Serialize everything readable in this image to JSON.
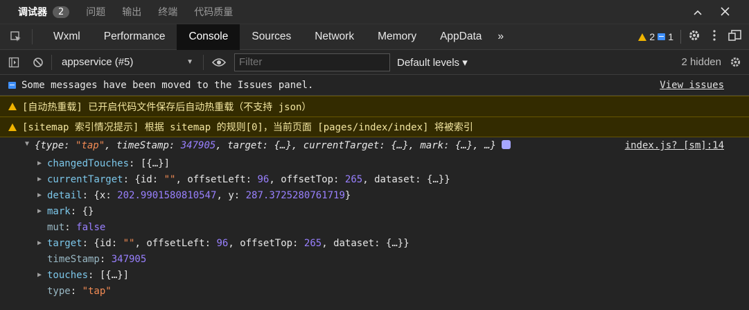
{
  "panel_tabs": {
    "debugger": "调试器",
    "debugger_count": "2",
    "issues": "问题",
    "output": "输出",
    "terminal": "终端",
    "code_quality": "代码质量"
  },
  "dev_tabs": [
    "Wxml",
    "Performance",
    "Console",
    "Sources",
    "Network",
    "Memory",
    "AppData"
  ],
  "dev_tabs_more": "»",
  "status": {
    "warnings": "2",
    "infos": "1"
  },
  "toolbar": {
    "context": "appservice (#5)",
    "filter_placeholder": "Filter",
    "levels": "Default levels ▾",
    "hidden": "2 hidden"
  },
  "messages": {
    "info_text": "Some messages have been moved to the Issues panel.",
    "view_issues": "View issues",
    "warn1": "[自动热重载] 已开启代码文件保存后自动热重载（不支持 json）",
    "warn2": "[sitemap 索引情况提示] 根据 sitemap 的规则[0]，当前页面 [pages/index/index] 将被索引"
  },
  "log": {
    "source": "index.js? [sm]:14",
    "head": {
      "open": "{",
      "k_type": "type",
      "v_type": "\"tap\"",
      "k_ts": "timeStamp",
      "v_ts": "347905",
      "k_target": "target",
      "v_target": "{…}",
      "k_ct": "currentTarget",
      "v_ct": "{…}",
      "k_mark": "mark",
      "v_mark": "{…}",
      "tail": "…}"
    },
    "changedTouches": {
      "key": "changedTouches",
      "val": "[{…}]"
    },
    "currentTarget": {
      "key": "currentTarget",
      "id_key": "id",
      "id_val": "\"\"",
      "ol_key": "offsetLeft",
      "ol_val": "96",
      "ot_key": "offsetTop",
      "ot_val": "265",
      "ds_key": "dataset",
      "ds_val": "{…}"
    },
    "detail": {
      "key": "detail",
      "x_key": "x",
      "x_val": "202.9901580810547",
      "y_key": "y",
      "y_val": "287.3725280761719"
    },
    "mark": {
      "key": "mark",
      "val": "{}"
    },
    "mut": {
      "key": "mut",
      "val": "false"
    },
    "target": {
      "key": "target",
      "id_key": "id",
      "id_val": "\"\"",
      "ol_key": "offsetLeft",
      "ol_val": "96",
      "ot_key": "offsetTop",
      "ot_val": "265",
      "ds_key": "dataset",
      "ds_val": "{…}"
    },
    "timeStamp": {
      "key": "timeStamp",
      "val": "347905"
    },
    "touches": {
      "key": "touches",
      "val": "[{…}]"
    },
    "type": {
      "key": "type",
      "val": "\"tap\""
    }
  }
}
